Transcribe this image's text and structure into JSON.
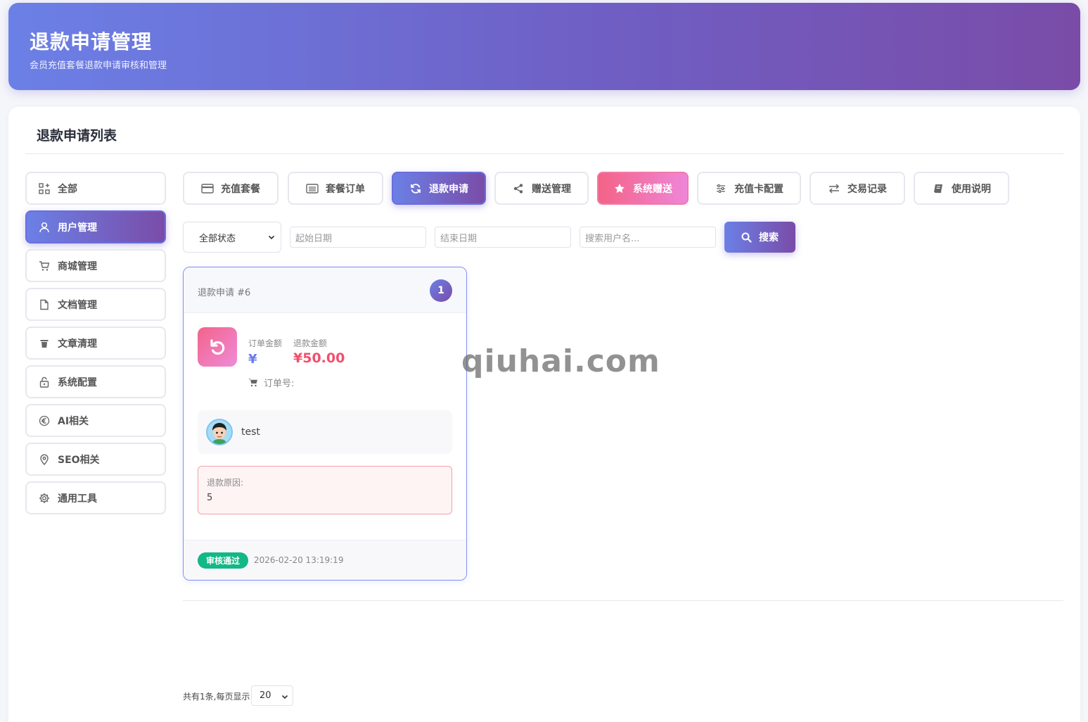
{
  "header": {
    "title": "退款申请管理",
    "subtitle": "会员充值套餐退款申请审核和管理"
  },
  "panel": {
    "title": "退款申请列表"
  },
  "sidebar": {
    "items": [
      {
        "label": "全部",
        "icon": "grid-icon",
        "active": false
      },
      {
        "label": "用户管理",
        "icon": "user-icon",
        "active": true
      },
      {
        "label": "商城管理",
        "icon": "cart-icon",
        "active": false
      },
      {
        "label": "文档管理",
        "icon": "file-icon",
        "active": false
      },
      {
        "label": "文章清理",
        "icon": "trash-icon",
        "active": false
      },
      {
        "label": "系统配置",
        "icon": "lock-icon",
        "active": false
      },
      {
        "label": "AI相关",
        "icon": "euro-icon",
        "active": false
      },
      {
        "label": "SEO相关",
        "icon": "location-icon",
        "active": false
      },
      {
        "label": "通用工具",
        "icon": "gear-icon",
        "active": false
      }
    ]
  },
  "tabs": [
    {
      "label": "充值套餐",
      "icon": "card-icon"
    },
    {
      "label": "套餐订单",
      "icon": "list-icon"
    },
    {
      "label": "退款申请",
      "icon": "refresh-icon",
      "active": true
    },
    {
      "label": "赠送管理",
      "icon": "share-icon"
    },
    {
      "label": "系统赠送",
      "icon": "star-icon"
    },
    {
      "label": "充值卡配置",
      "icon": "sliders-icon"
    },
    {
      "label": "交易记录",
      "icon": "exchange-icon"
    },
    {
      "label": "使用说明",
      "icon": "book-icon"
    }
  ],
  "filters": {
    "status_selected": "全部状态",
    "start_date_placeholder": "起始日期",
    "end_date_placeholder": "结束日期",
    "username_placeholder": "搜索用户名...",
    "search_label": "搜索"
  },
  "card": {
    "title": "退款申请 #6",
    "index": "1",
    "order_amount_label": "订单金额",
    "order_amount": "¥",
    "refund_amount_label": "退款金额",
    "refund_amount": "¥50.00",
    "order_no_label": "订单号:",
    "username": "test",
    "reason_label": "退款原因:",
    "reason": "5",
    "status": "审核通过",
    "time": "2026-02-20 13:19:19"
  },
  "pagination": {
    "summary": "共有1条,每页显示",
    "page_size": "20"
  },
  "watermark": "qiuhai.com",
  "colors": {
    "accent_start": "#6b80e6",
    "accent_end": "#7a4ca8",
    "pink_start": "#f36386",
    "pink_end": "#ef86d8",
    "success": "#12b886",
    "danger": "#f0506e"
  }
}
